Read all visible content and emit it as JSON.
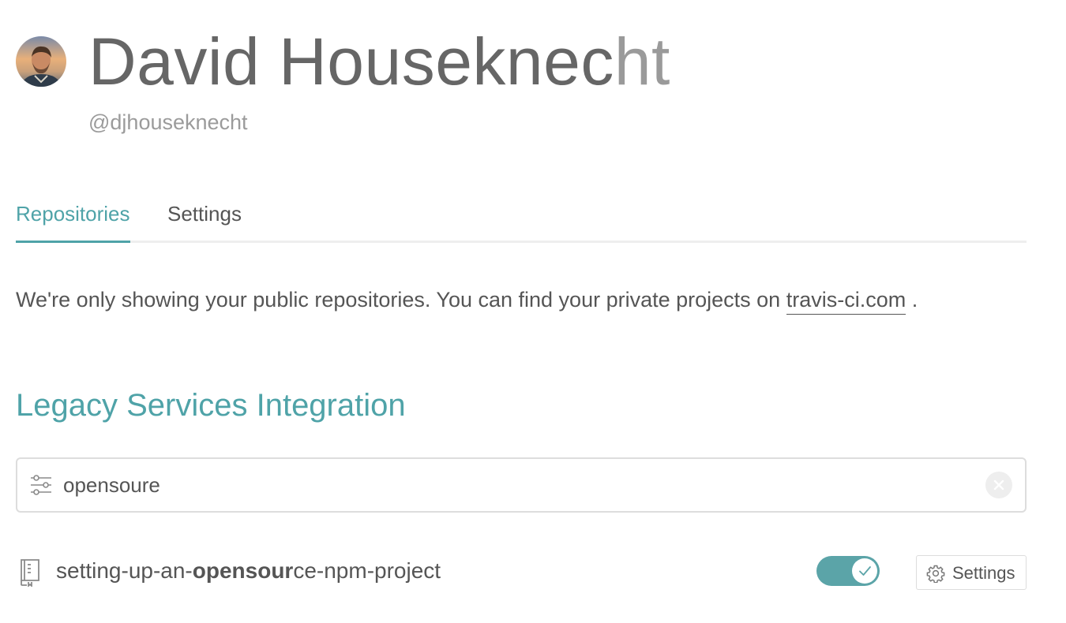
{
  "profile": {
    "name_main": "David Houseknec",
    "name_faded": "ht",
    "handle": "@djhouseknecht",
    "avatar_icon": "user-avatar-photo"
  },
  "tabs": [
    {
      "label": "Repositories",
      "active": true
    },
    {
      "label": "Settings",
      "active": false
    }
  ],
  "info": {
    "text": "We're only showing your public repositories. You can find your private projects on ",
    "link_text": "travis-ci.com",
    "suffix": " ."
  },
  "section": {
    "title": "Legacy Services Integration"
  },
  "search": {
    "value": "opensoure",
    "filter_icon": "filter-sliders-icon",
    "clear_icon": "clear-circle-icon"
  },
  "repositories": [
    {
      "name_prefix": "setting-up-an-",
      "name_match": "opensour",
      "name_suffix": "ce-npm-project",
      "enabled": true,
      "settings_label": "Settings"
    }
  ],
  "colors": {
    "accent": "#4fa3a8",
    "toggle_on": "#5ba4a8",
    "text": "#555555",
    "muted": "#9b9b9b"
  }
}
